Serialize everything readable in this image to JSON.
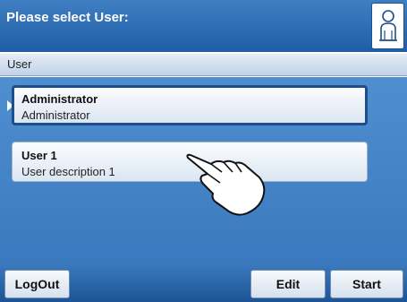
{
  "header": {
    "title": "Please select User:",
    "icon": "user-icon"
  },
  "list_header": {
    "label": "User"
  },
  "users": [
    {
      "name": "Administrator",
      "description": "Administrator",
      "selected": true
    },
    {
      "name": "User 1",
      "description": "User description 1",
      "selected": false
    }
  ],
  "footer": {
    "logout_label": "LogOut",
    "edit_label": "Edit",
    "start_label": "Start"
  }
}
